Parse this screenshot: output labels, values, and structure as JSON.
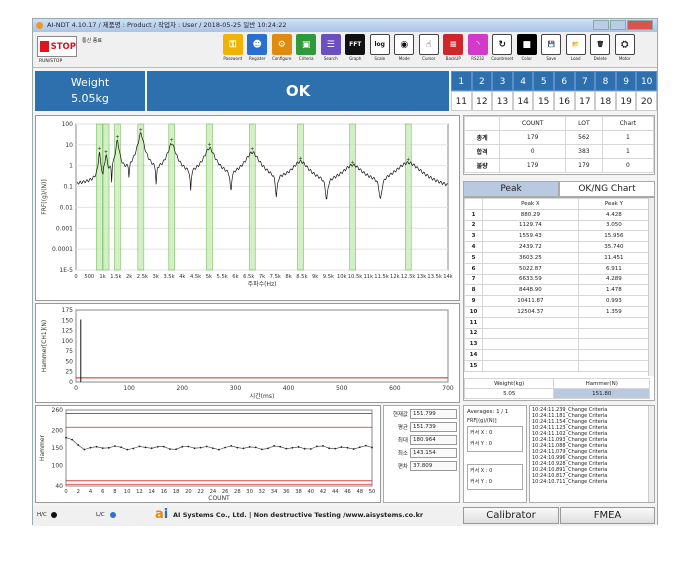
{
  "window": {
    "title": "AI-NDT 4.10.17 / 제품명 : Product / 작업자 : User / 2018-05-25 일반 10:24:22"
  },
  "toolbar": {
    "stop_label": "STOP",
    "runstop_label": "RUN/STOP",
    "comm_label": "통신 종료",
    "tools": [
      {
        "label": "Password",
        "icon": "key-icon",
        "color": "#f0b400",
        "glyph": "⚿"
      },
      {
        "label": "Register",
        "icon": "users-icon",
        "color": "#2a6fd0",
        "glyph": "☻"
      },
      {
        "label": "Configure",
        "icon": "gears-icon",
        "color": "#e08a10",
        "glyph": "⚙"
      },
      {
        "label": "Criteria",
        "icon": "cube-icon",
        "color": "#2f9a3a",
        "glyph": "▣"
      },
      {
        "label": "Search",
        "icon": "list-icon",
        "color": "#6b4fc0",
        "glyph": "☰"
      },
      {
        "label": "Graph",
        "icon": "fft-icon",
        "color": "#111111",
        "glyph": "FFT"
      },
      {
        "label": "Scale",
        "icon": "log-icon",
        "color": "#ffffff",
        "glyph": "log"
      },
      {
        "label": "Mode",
        "icon": "eye-icon",
        "color": "#ffffff",
        "glyph": "◉"
      },
      {
        "label": "Cursor",
        "icon": "hand-icon",
        "color": "#ffffff",
        "glyph": "☝"
      },
      {
        "label": "BackUP",
        "icon": "database-icon",
        "color": "#d0262b",
        "glyph": "≡"
      },
      {
        "label": "RS232",
        "icon": "rss-icon",
        "color": "#d43aca",
        "glyph": "◝"
      },
      {
        "label": "Countreset",
        "icon": "refresh-icon",
        "color": "#ffffff",
        "glyph": "↻"
      },
      {
        "label": "Color",
        "icon": "color-icon",
        "color": "#000000",
        "glyph": "■"
      },
      {
        "label": "Save",
        "icon": "save-icon",
        "color": "#ffffff",
        "glyph": "💾"
      },
      {
        "label": "Load",
        "icon": "folder-icon",
        "color": "#ffffff",
        "glyph": "📂"
      },
      {
        "label": "Delete",
        "icon": "trash-icon",
        "color": "#ffffff",
        "glyph": "🗑"
      },
      {
        "label": "Motor",
        "icon": "motor-icon",
        "color": "#ffffff",
        "glyph": "⛭"
      }
    ]
  },
  "weight": {
    "label": "Weight",
    "value": "5.05kg"
  },
  "status": {
    "result": "OK"
  },
  "channels": [
    "1",
    "2",
    "3",
    "4",
    "5",
    "6",
    "7",
    "8",
    "9",
    "10",
    "11",
    "12",
    "13",
    "14",
    "15",
    "16",
    "17",
    "18",
    "19",
    "20"
  ],
  "count_table": {
    "headers": [
      "",
      "COUNT",
      "LOT",
      "Chart"
    ],
    "rows": [
      {
        "label": "총계",
        "count": "179",
        "lot": "562",
        "chart": "1"
      },
      {
        "label": "합격",
        "count": "0",
        "lot": "383",
        "chart": "1"
      },
      {
        "label": "불량",
        "count": "179",
        "lot": "179",
        "chart": "0"
      }
    ]
  },
  "peak_tabs": {
    "peak": "Peak",
    "okng": "OK/NG Chart"
  },
  "peak_table": {
    "headers": [
      "",
      "Peak X",
      "Peak Y"
    ],
    "rows": [
      [
        "1",
        "880.29",
        "4.428"
      ],
      [
        "2",
        "1129.74",
        "3.050"
      ],
      [
        "3",
        "1559.43",
        "15.956"
      ],
      [
        "4",
        "2439.72",
        "35.740"
      ],
      [
        "5",
        "3603.25",
        "11.451"
      ],
      [
        "6",
        "5022.87",
        "6.911"
      ],
      [
        "7",
        "6633.59",
        "4.289"
      ],
      [
        "8",
        "8448.90",
        "1.478"
      ],
      [
        "9",
        "10411.87",
        "0.993"
      ],
      [
        "10",
        "12504.37",
        "1.359"
      ],
      [
        "11",
        "",
        ""
      ],
      [
        "12",
        "",
        ""
      ],
      [
        "13",
        "",
        ""
      ],
      [
        "14",
        "",
        ""
      ],
      [
        "15",
        "",
        ""
      ]
    ],
    "footer_headers": [
      "Weight(kg)",
      "Hammer(N)"
    ],
    "footer_values": [
      "5.05",
      "151.80"
    ]
  },
  "frf_chart": {
    "ylabel": "FRF[(g)/(N)]",
    "xlabel": "주파수(Hz)",
    "yticks": [
      "100",
      "10",
      "1",
      "0.1",
      "0.01",
      "0.001",
      "0.0001",
      "1E-5"
    ],
    "xticks": [
      "0",
      "500",
      "1k",
      "1.5k",
      "2k",
      "2.5k",
      "3k",
      "3.5k",
      "4k",
      "4.5k",
      "5k",
      "5.5k",
      "6k",
      "6.5k",
      "7k",
      "7.5k",
      "8k",
      "8.5k",
      "9k",
      "9.5k",
      "10k",
      "10.5k",
      "11k",
      "11.5k",
      "12k",
      "12.5k",
      "13k",
      "13.5k",
      "14k"
    ]
  },
  "hammer_chart": {
    "ylabel": "Hammer[CH1](N)",
    "xlabel": "시간(ms)",
    "yticks": [
      "175",
      "150",
      "125",
      "100",
      "75",
      "50",
      "25",
      "0"
    ],
    "xticks": [
      "0",
      "100",
      "200",
      "300",
      "400",
      "500",
      "600",
      "700"
    ]
  },
  "trend_chart": {
    "ylabel": "Hammer",
    "xlabel": "COUNT",
    "yticks": [
      "260",
      "200",
      "150",
      "100",
      "40"
    ],
    "xticks": [
      "0",
      "2",
      "4",
      "6",
      "8",
      "10",
      "12",
      "14",
      "16",
      "18",
      "20",
      "22",
      "24",
      "26",
      "28",
      "30",
      "32",
      "34",
      "36",
      "38",
      "40",
      "42",
      "44",
      "46",
      "48",
      "50"
    ]
  },
  "stats": [
    {
      "label": "현재값",
      "value": "151.799"
    },
    {
      "label": "평균",
      "value": "151.739"
    },
    {
      "label": "최대",
      "value": "180.964"
    },
    {
      "label": "최소",
      "value": "143.154"
    },
    {
      "label": "편차",
      "value": "37.809"
    }
  ],
  "cursor_panel": {
    "averages_label": "Averages:",
    "averages_value": "1 / 1",
    "unit": "FRF[(g)/(N)]",
    "cursor_x": "커서 X : 0",
    "cursor_y": "커서 Y : 0",
    "cursor_x2": "커서 X : 0",
    "cursor_y2": "커서 Y : 0"
  },
  "log": [
    "10:24:11.239_Change Criteria",
    "10:24:11.181_Change Criteria",
    "10:24:11.154_Change Criteria",
    "10:24:11.123_Change Criteria",
    "10:24:11.102_Change Criteria",
    "10:24:11.093_Change Criteria",
    "10:24:11.088_Change Criteria",
    "10:24:11.079_Change Criteria",
    "10:24:10.996_Change Criteria",
    "10:24:10.928_Change Criteria",
    "10:24:10.891_Change Criteria",
    "10:24:10.817_Change Criteria",
    "10:24:10.711_Change Criteria"
  ],
  "footer": {
    "hc": "H/C",
    "lc": "L/C",
    "company": "AI Systems Co., Ltd. | Non destructive Testing /www.aisystems.co.kr",
    "calibrator": "Calibrator",
    "fmea": "FMEA"
  }
}
